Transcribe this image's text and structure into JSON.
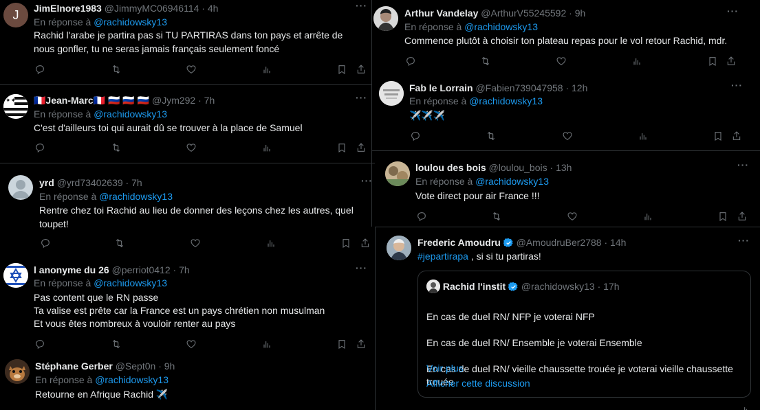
{
  "colors": {
    "background": "#000000",
    "text": "#e7e9ea",
    "muted": "#71767b",
    "link": "#1d9bf0",
    "border": "#2f3336"
  },
  "reply_prefix": "En réponse à",
  "reply_to": "@rachidowsky13",
  "left": [
    {
      "name": "JimElnore1983",
      "handle": "@JimmyMC06946114",
      "time": "4h",
      "avatar": "J",
      "text": "Rachid l'arabe je partira pas si TU PARTIRAS dans ton pays et arrête de nous gonfler, tu ne seras jamais français seulement foncé"
    },
    {
      "name": "🇫🇷Jean-Marc🇫🇷 🇷🇺 🇷🇺 🇷🇺",
      "handle": "@Jym292",
      "time": "7h",
      "avatar": "flag",
      "text": "C'est d'ailleurs toi qui aurait  dû se trouver à la place de Samuel"
    },
    {
      "name": "yrd",
      "handle": "@yrd73402639",
      "time": "7h",
      "avatar": "default",
      "text": "Rentre chez toi Rachid au lieu de donner des leçons chez les autres, quel toupet!"
    },
    {
      "name": "l anonyme du 26",
      "handle": "@perriot0412",
      "time": "7h",
      "avatar": "star",
      "text": "Pas content  que le  RN passe\nTa valise est prête car la France est un pays chrétien non musulman\nEt vous êtes nombreux à  vouloir renter au pays"
    },
    {
      "name": "Stéphane Gerber",
      "handle": "@Sept0n",
      "time": "9h",
      "avatar": "squirrel",
      "text": "Retourne en Afrique Rachid ✈️"
    }
  ],
  "right": [
    {
      "name": "Arthur Vandelay",
      "handle": "@ArthurV55245592",
      "time": "9h",
      "text": "Commence plutôt à choisir ton plateau repas pour le vol retour Rachid, mdr."
    },
    {
      "name": "Fab le Lorrain",
      "handle": "@Fabien739047958",
      "time": "12h",
      "text": "✈️✈️✈️"
    },
    {
      "name": "loulou des bois",
      "handle": "@loulou_bois",
      "time": "13h",
      "text": "Vote direct pour air France !!!"
    },
    {
      "name": "Frederic Amoudru",
      "handle": "@AmoudruBer2788",
      "time": "14h",
      "hashtag": "#jepartirapa",
      "text_after": " ,  si  si tu partiras!"
    }
  ],
  "quote": {
    "name": "Rachid l'instit",
    "handle": "@rachidowsky13",
    "time": "17h",
    "lines": [
      "En cas de duel RN/ NFP je voterai NFP",
      "En cas de duel RN/ Ensemble je voterai Ensemble",
      "En cas de duel RN/ vieille chaussette trouée je voterai vieille chaussette trouée",
      "..."
    ],
    "show_more": "Voir plus",
    "show_thread": "Afficher cette discussion"
  },
  "icons": [
    "more-icon",
    "reply-icon",
    "retweet-icon",
    "like-icon",
    "views-icon",
    "bookmark-icon",
    "share-icon",
    "verified-icon"
  ]
}
